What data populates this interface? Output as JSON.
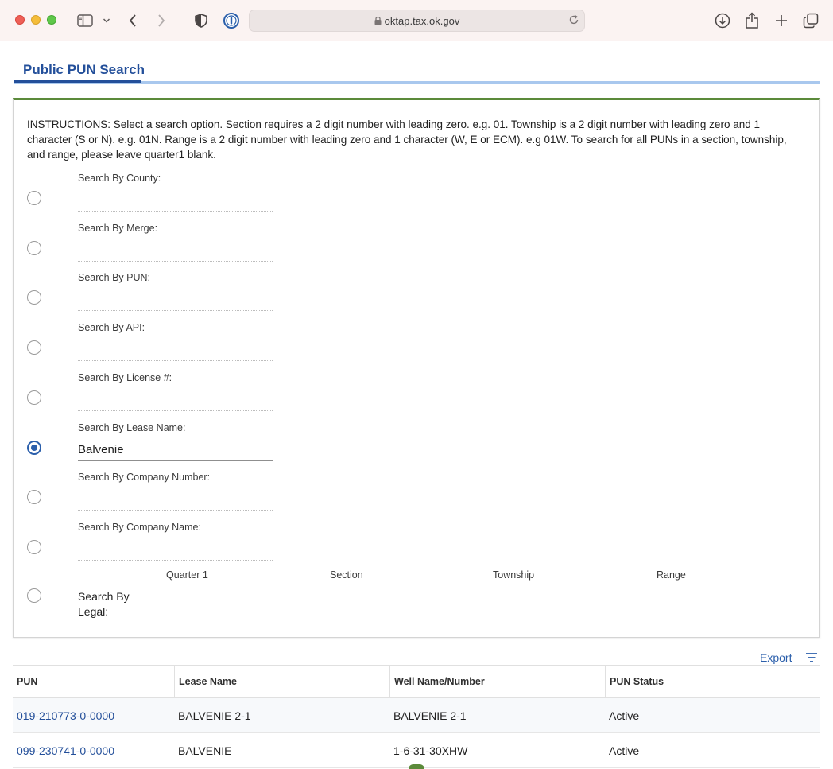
{
  "browser": {
    "url": "oktap.tax.ok.gov"
  },
  "page": {
    "tab_title": "Public PUN Search",
    "instructions": "INSTRUCTIONS: Select a search option. Section requires a 2 digit number with leading zero. e.g. 01. Township is a 2 digit number with leading zero and 1 character (S or N). e.g. 01N. Range is a 2 digit number with leading zero and 1 character (W, E or ECM). e.g 01W. To search for all PUNs in a section, township, and range, please leave quarter1 blank."
  },
  "search_options": [
    {
      "label": "Search By County:",
      "value": "",
      "selected": false
    },
    {
      "label": "Search By Merge:",
      "value": "",
      "selected": false
    },
    {
      "label": "Search By PUN:",
      "value": "",
      "selected": false
    },
    {
      "label": "Search By API:",
      "value": "",
      "selected": false
    },
    {
      "label": "Search By License #:",
      "value": "",
      "selected": false
    },
    {
      "label": "Search By Lease Name:",
      "value": "Balvenie",
      "selected": true
    },
    {
      "label": "Search By Company Number:",
      "value": "",
      "selected": false
    },
    {
      "label": "Search By Company Name:",
      "value": "",
      "selected": false
    }
  ],
  "legal": {
    "label_line1": "Search By",
    "label_line2": "Legal:",
    "columns": [
      "Quarter 1",
      "Section",
      "Township",
      "Range"
    ]
  },
  "results": {
    "export_label": "Export",
    "columns": [
      "PUN",
      "Lease Name",
      "Well Name/Number",
      "PUN Status"
    ],
    "rows": [
      [
        "019-210773-0-0000",
        "BALVENIE 2-1",
        "BALVENIE 2-1",
        "Active"
      ],
      [
        "099-230741-0-0000",
        "BALVENIE",
        "1-6-31-30XHW",
        "Active"
      ]
    ]
  }
}
